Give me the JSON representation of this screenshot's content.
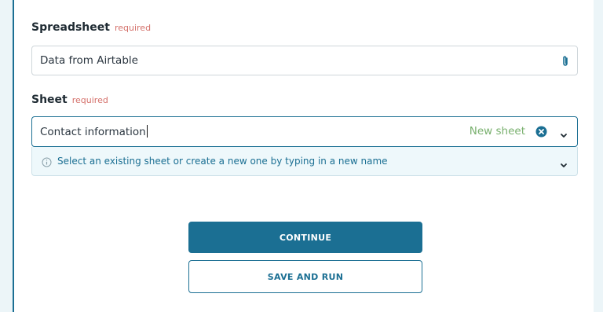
{
  "spreadsheet": {
    "label": "Spreadsheet",
    "required": "required",
    "value": "Data from Airtable",
    "icon": "paperclip-icon"
  },
  "sheet": {
    "label": "Sheet",
    "required": "required",
    "value": "Contact information",
    "badge": "New sheet",
    "clear_icon": "clear-icon",
    "dropdown_icon": "chevron-down-icon"
  },
  "hint": {
    "text": "Select an existing sheet or create a new one by typing in a new name",
    "icon": "info-icon"
  },
  "actions": {
    "continue_label": "CONTINUE",
    "save_run_label": "SAVE AND RUN"
  },
  "colors": {
    "accent": "#1b6f93",
    "required": "#d4706a",
    "new_sheet": "#79b06e",
    "hint_bg": "#eef8fb"
  }
}
